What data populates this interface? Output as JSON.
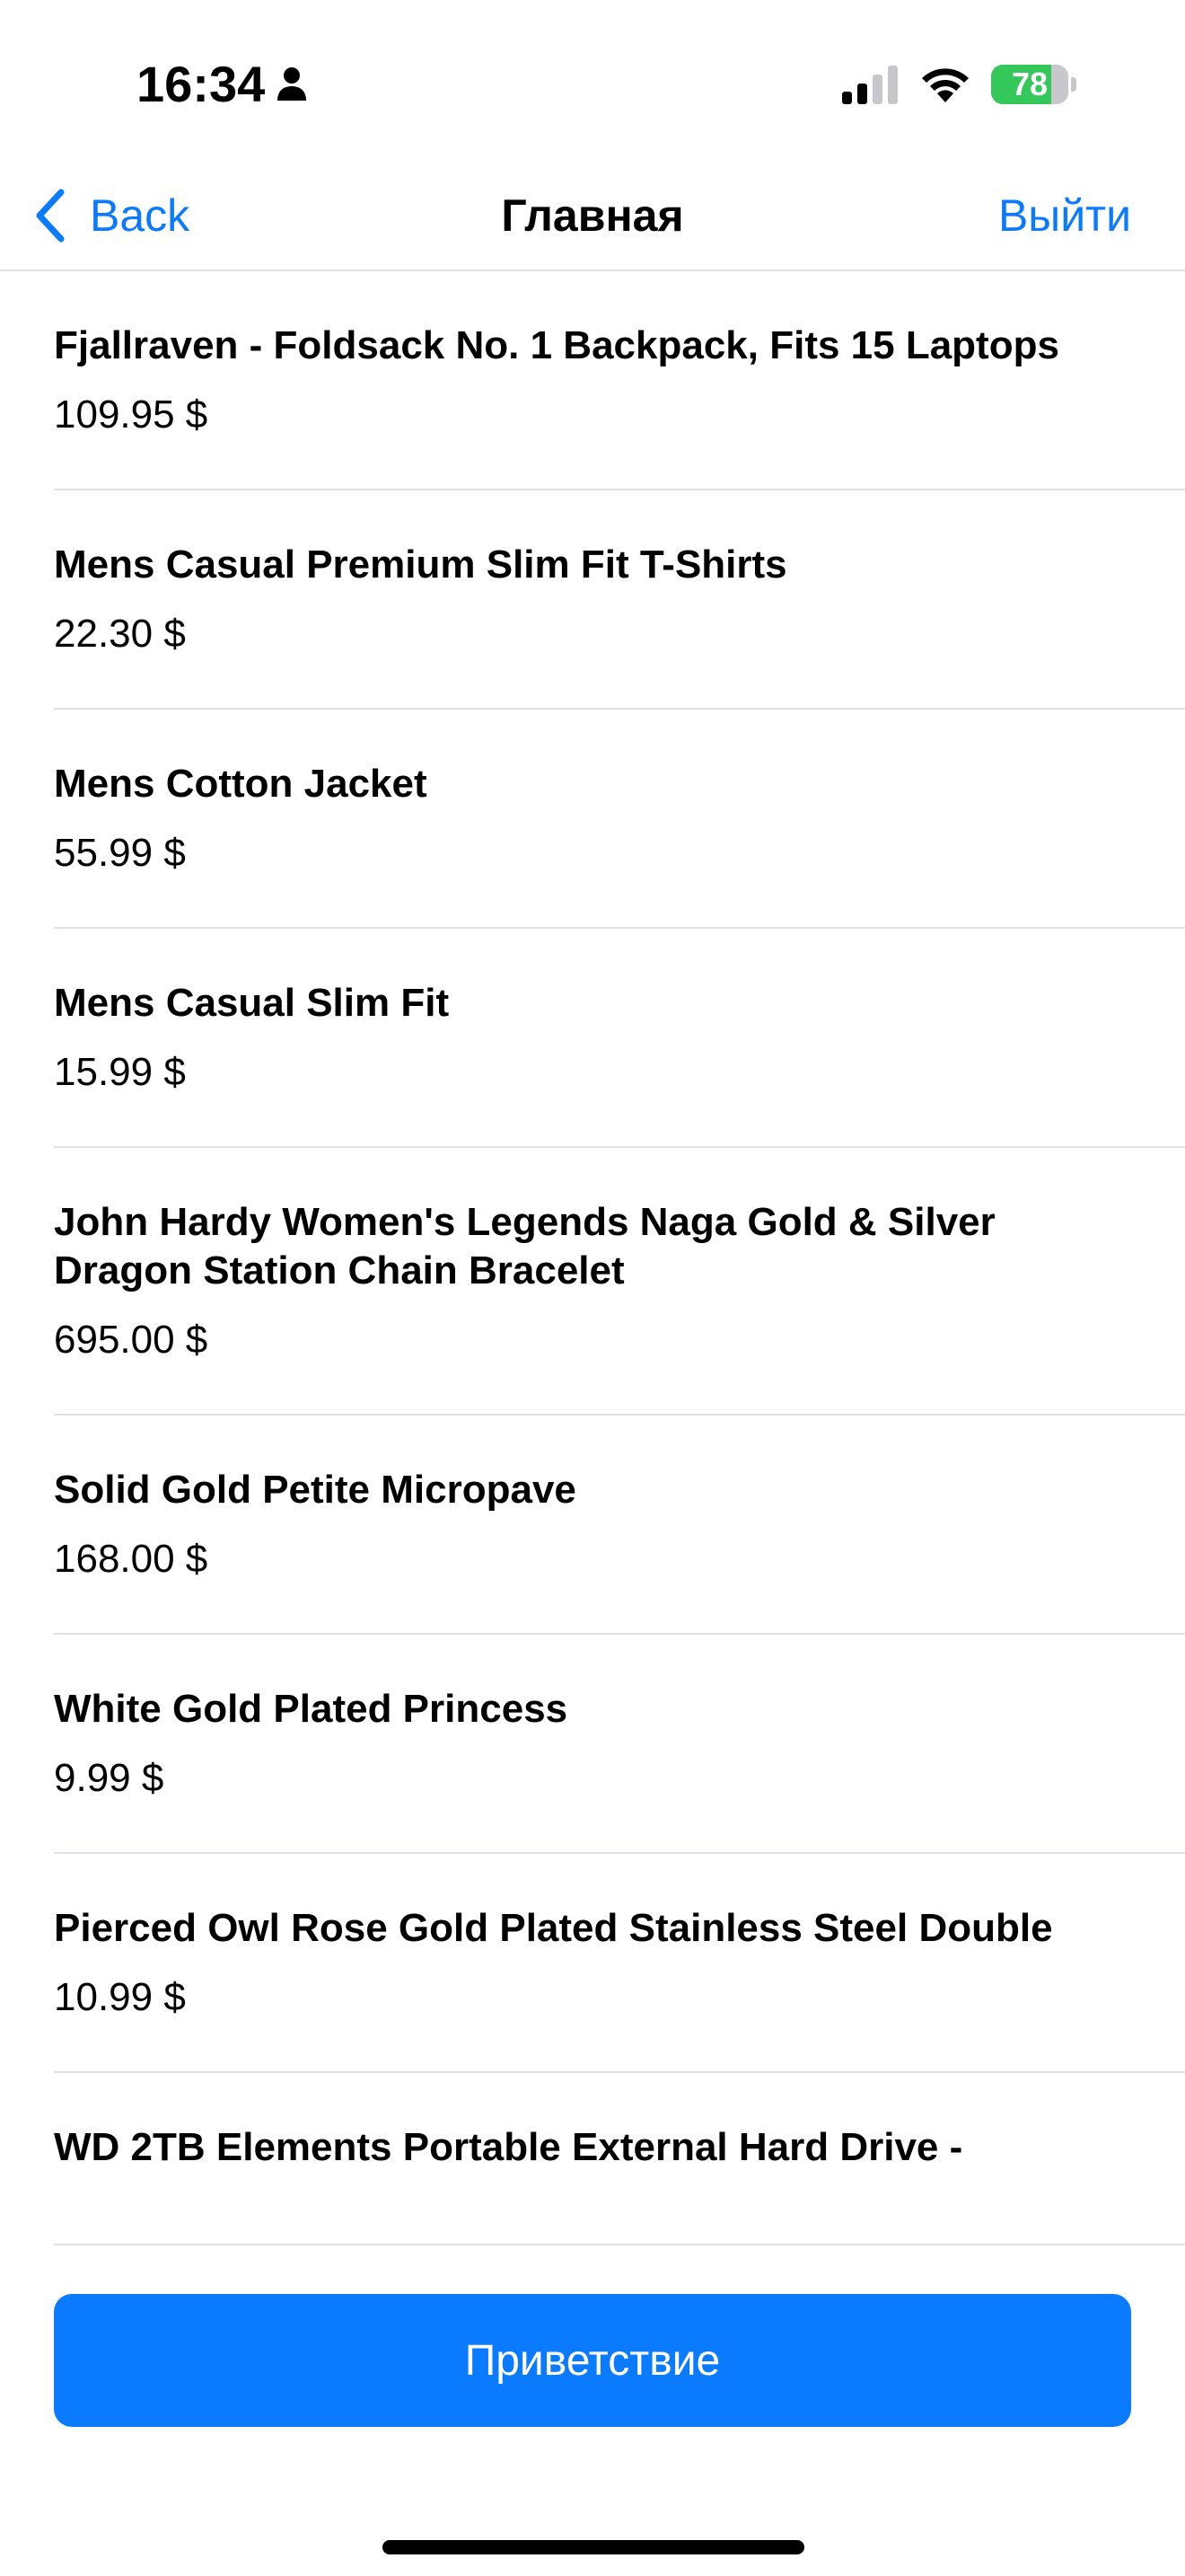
{
  "status_bar": {
    "time": "16:34",
    "battery_percent": 78,
    "battery_text": "78",
    "icons": [
      "person-icon",
      "signal-icon",
      "wifi-icon",
      "battery-icon"
    ],
    "battery_color": "#34c759"
  },
  "nav": {
    "back_label": "Back",
    "title": "Главная",
    "logout_label": "Выйти",
    "accent_color": "#0a7aff"
  },
  "products": [
    {
      "title": "Fjallraven - Foldsack No. 1 Backpack, Fits 15 Laptops",
      "price": "109.95 $"
    },
    {
      "title": "Mens Casual Premium Slim Fit T-Shirts",
      "price": "22.30 $"
    },
    {
      "title": "Mens Cotton Jacket",
      "price": "55.99 $"
    },
    {
      "title": "Mens Casual Slim Fit",
      "price": "15.99 $"
    },
    {
      "title": "John Hardy Women's Legends Naga Gold & Silver Dragon Station Chain Bracelet",
      "price": "695.00 $"
    },
    {
      "title": "Solid Gold Petite Micropave",
      "price": "168.00 $"
    },
    {
      "title": "White Gold Plated Princess",
      "price": "9.99 $"
    },
    {
      "title": "Pierced Owl Rose Gold Plated Stainless Steel Double",
      "price": "10.99 $"
    },
    {
      "title": "WD 2TB Elements Portable External Hard Drive -",
      "price": ""
    }
  ],
  "bottom_button": {
    "label": "Приветствие",
    "color": "#0a7aff"
  }
}
